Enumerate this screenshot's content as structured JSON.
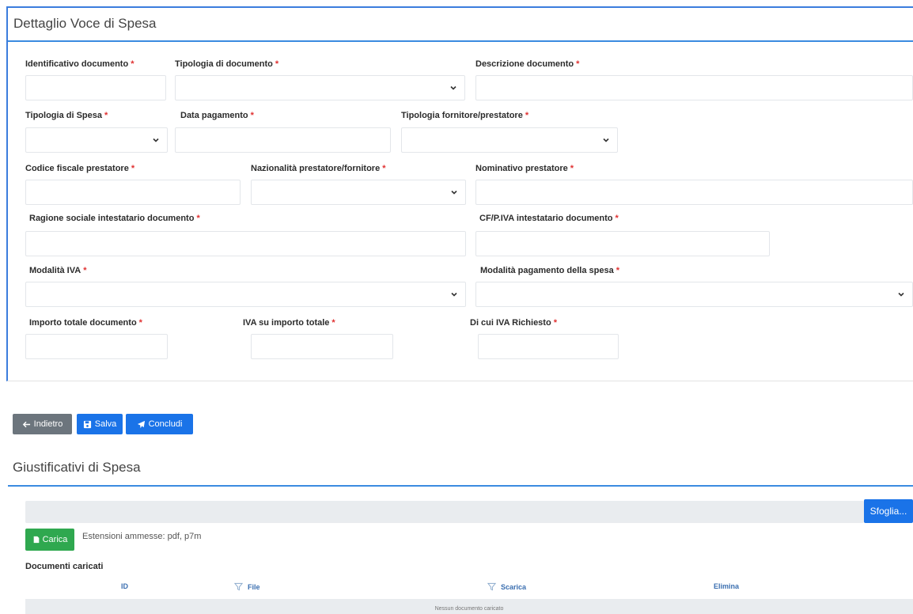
{
  "detail": {
    "title": "Dettaglio Voce di Spesa",
    "fields": {
      "id_documento": "Identificativo documento",
      "tipologia_documento": "Tipologia di documento",
      "descrizione_documento": "Descrizione documento",
      "tipologia_spesa": "Tipologia di Spesa",
      "data_pagamento": "Data pagamento",
      "tipologia_fornitore": "Tipologia fornitore/prestatore",
      "codice_fiscale": "Codice fiscale prestatore",
      "nazionalita": "Nazionalità prestatore/fornitore",
      "nominativo": "Nominativo prestatore",
      "ragione_sociale": "Ragione sociale intestatario documento",
      "cf_piva": "CF/P.IVA intestatario documento",
      "modalita_iva": "Modalità IVA",
      "modalita_pagamento": "Modalità pagamento della spesa",
      "importo_totale": "Importo totale documento",
      "iva_importo": "IVA su importo totale",
      "iva_richiesto": "Di cui IVA Richiesto"
    },
    "required_mark": "*"
  },
  "actions": {
    "back": "Indietro",
    "save": "Salva",
    "conclude": "Concludi"
  },
  "giustificativi": {
    "title": "Giustificativi di Spesa",
    "browse": "Sfoglia...",
    "upload": "Carica",
    "extensions": "Estensioni ammesse: pdf, p7m",
    "documents_label": "Documenti caricati",
    "columns": [
      "ID",
      "File",
      "Scarica",
      "Elimina"
    ],
    "empty": "Nessun documento caricato"
  },
  "colors": {
    "accent": "#1a73e8",
    "success": "#2fa84f",
    "secondary": "#6c757d",
    "required": "#e03131"
  }
}
